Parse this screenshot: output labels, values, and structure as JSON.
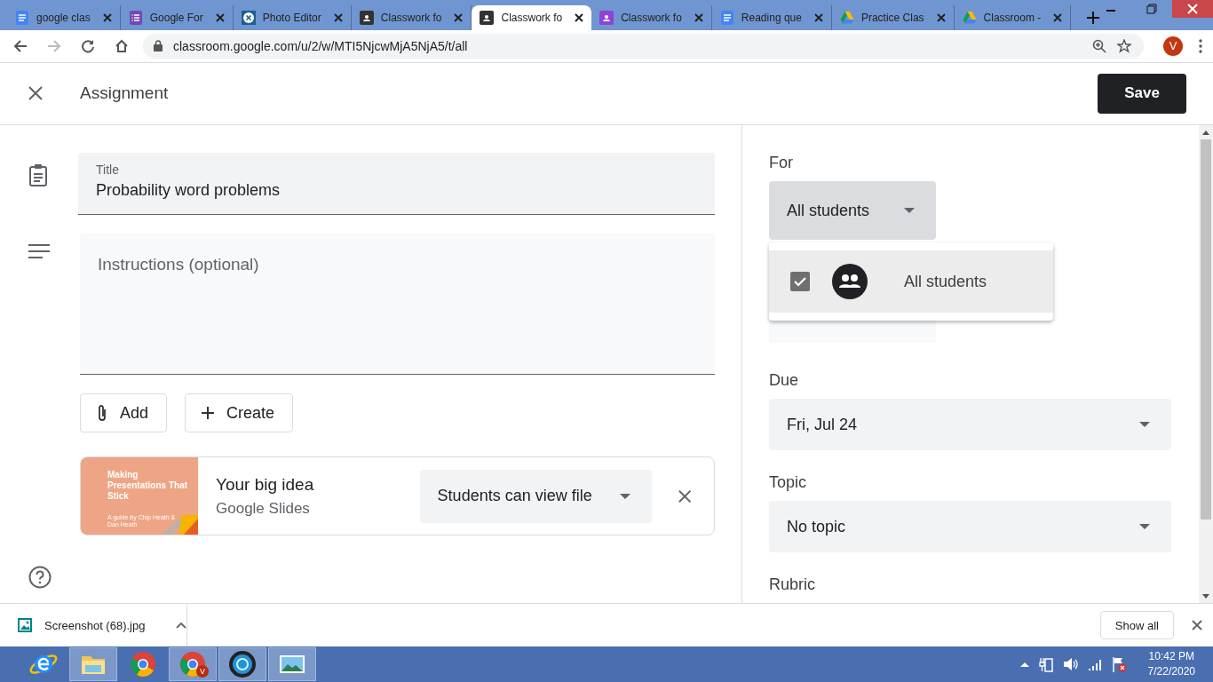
{
  "browser": {
    "tabs": [
      {
        "title": "google clas",
        "kind": "docs",
        "selected": false
      },
      {
        "title": "Google For",
        "kind": "forms",
        "selected": false
      },
      {
        "title": "Photo Editor",
        "kind": "editor",
        "selected": false
      },
      {
        "title": "Classwork fo",
        "kind": "classroom",
        "selected": false
      },
      {
        "title": "Classwork fo",
        "kind": "classroom",
        "selected": true
      },
      {
        "title": "Classwork fo",
        "kind": "classroomalt",
        "selected": false
      },
      {
        "title": "Reading que",
        "kind": "docs",
        "selected": false
      },
      {
        "title": "Practice Clas",
        "kind": "drive",
        "selected": false
      },
      {
        "title": "Classroom -",
        "kind": "drive",
        "selected": false
      }
    ],
    "url": "classroom.google.com/u/2/w/MTI5NjcwMjA5NjA5/t/all",
    "avatar": "V"
  },
  "header": {
    "title": "Assignment",
    "save": "Save"
  },
  "form": {
    "title_label": "Title",
    "title_value": "Probability word problems",
    "instructions_placeholder": "Instructions (optional)",
    "buttons": [
      {
        "label": "Add",
        "kind": "attach"
      },
      {
        "label": "Create",
        "kind": "plus"
      }
    ],
    "attachment": {
      "thumbnail": {
        "heading": "Making Presentations That Stick",
        "byline": "A guide by Chip Heath & Dan Heath"
      },
      "name": "Your big idea",
      "type": "Google Slides",
      "permission": "Students can view file"
    }
  },
  "panel": {
    "for_label": "For",
    "for_value": "All students",
    "menu": [
      {
        "label": "All students",
        "checked": true
      }
    ],
    "due_label": "Due",
    "due_value": "Fri, Jul 24",
    "topic_label": "Topic",
    "topic_value": "No topic",
    "rubric_label": "Rubric"
  },
  "downloads": {
    "file": "Screenshot (68).jpg",
    "show_all": "Show all"
  },
  "taskbar": {
    "apps": [
      {
        "kind": "ie",
        "open": false
      },
      {
        "kind": "folder",
        "open": true
      },
      {
        "kind": "chrome",
        "open": false
      },
      {
        "kind": "chrome",
        "open": true,
        "badge": "V"
      },
      {
        "kind": "media",
        "open": true
      },
      {
        "kind": "photos",
        "open": true
      }
    ],
    "time": "10:42 PM",
    "date": "7/22/2020"
  }
}
